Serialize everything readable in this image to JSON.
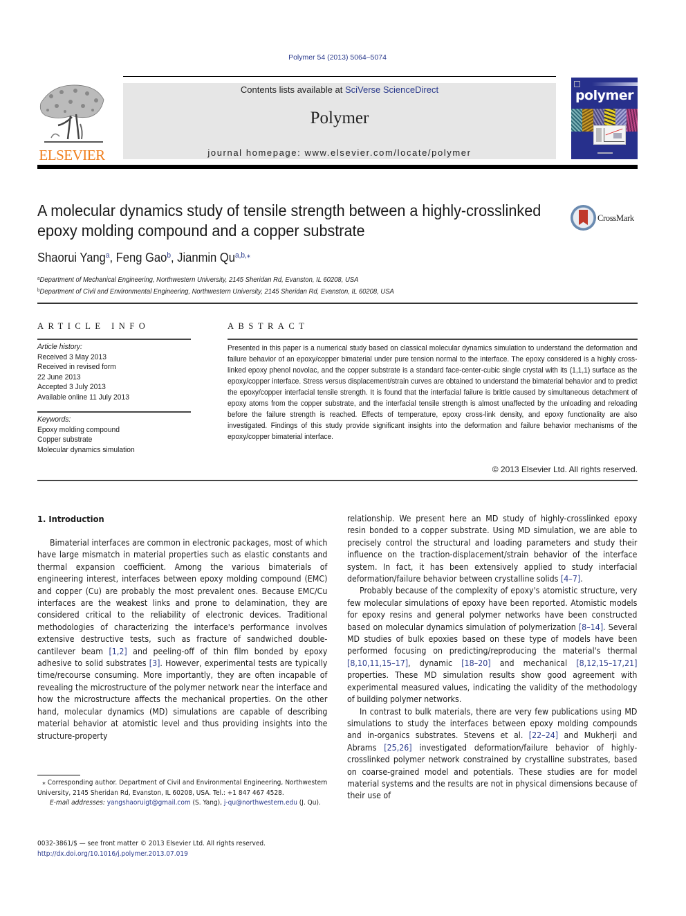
{
  "header": {
    "citation": "Polymer 54 (2013) 5064–5074",
    "contents_prefix": "Contents lists available at ",
    "contents_link": "SciVerse ScienceDirect",
    "journal_name": "Polymer",
    "homepage": "journal homepage: www.elsevier.com/locate/polymer",
    "publisher": "ELSEVIER",
    "cover_title": "polymer",
    "crossmark_label": "CrossMark"
  },
  "colors": {
    "link": "#2a3a8c",
    "elsevier_orange": "#f07f1e",
    "journal_box": "#e6e6e6",
    "cover_blue": "#27308c"
  },
  "article": {
    "title": "A molecular dynamics study of tensile strength between a highly-crosslinked epoxy molding compound and a copper substrate",
    "authors": [
      {
        "name": "Shaorui Yang",
        "sup": "a"
      },
      {
        "name": "Feng Gao",
        "sup": "b"
      },
      {
        "name": "Jianmin Qu",
        "sup": "a,b,⁎"
      }
    ],
    "affiliations": [
      {
        "mark": "a",
        "text": "Department of Mechanical Engineering, Northwestern University, 2145 Sheridan Rd, Evanston, IL 60208, USA"
      },
      {
        "mark": "b",
        "text": "Department of Civil and Environmental Engineering, Northwestern University, 2145 Sheridan Rd, Evanston, IL 60208, USA"
      }
    ]
  },
  "article_info": {
    "heading": "ARTICLE INFO",
    "history_label": "Article history:",
    "history": [
      "Received 3 May 2013",
      "Received in revised form",
      "22 June 2013",
      "Accepted 3 July 2013",
      "Available online 11 July 2013"
    ],
    "keywords_label": "Keywords:",
    "keywords": [
      "Epoxy molding compound",
      "Copper substrate",
      "Molecular dynamics simulation"
    ]
  },
  "abstract": {
    "heading": "ABSTRACT",
    "text": "Presented in this paper is a numerical study based on classical molecular dynamics simulation to understand the deformation and failure behavior of an epoxy/copper bimaterial under pure tension normal to the interface. The epoxy considered is a highly cross-linked epoxy phenol novolac, and the copper substrate is a standard face-center-cubic single crystal with its (1,1,1) surface as the epoxy/copper interface. Stress versus displacement/strain curves are obtained to understand the bimaterial behavior and to predict the epoxy/copper interfacial tensile strength. It is found that the interfacial failure is brittle caused by simultaneous detachment of epoxy atoms from the copper substrate, and the interfacial tensile strength is almost unaffected by the unloading and reloading before the failure strength is reached. Effects of temperature, epoxy cross-link density, and epoxy functionality are also investigated. Findings of this study provide significant insights into the deformation and failure behavior mechanisms of the epoxy/copper bimaterial interface.",
    "copyright": "© 2013 Elsevier Ltd. All rights reserved."
  },
  "body": {
    "section_heading": "1.  Introduction",
    "left_column": [
      {
        "text": "Bimaterial interfaces are common in electronic packages, most of which have large mismatch in material properties such as elastic constants and thermal expansion coefficient. Among the various bimaterials of engineering interest, interfaces between epoxy molding compound (EMC) and copper (Cu) are probably the most prevalent ones. Because EMC/Cu interfaces are the weakest links and prone to delamination, they are considered critical to the reliability of electronic devices. Traditional methodologies of characterizing the interface's performance involves extensive destructive tests, such as fracture of sandwiched double-cantilever beam "
      },
      {
        "ref": "[1,2]"
      },
      {
        "text": " and peeling-off of thin film bonded by epoxy adhesive to solid substrates "
      },
      {
        "ref": "[3]"
      },
      {
        "text": ". However, experimental tests are typically time/recourse consuming. More importantly, they are often incapable of revealing the microstructure of the polymer network near the interface and how the microstructure affects the mechanical properties. On the other hand, molecular dynamics (MD) simulations are capable of describing material behavior at atomistic level and thus providing insights into the structure-property"
      }
    ],
    "right_p1": [
      {
        "text": "relationship. We present here an MD study of highly-crosslinked epoxy resin bonded to a copper substrate. Using MD simulation, we are able to precisely control the structural and loading parameters and study their influence on the traction-displacement/strain behavior of the interface system. In fact, it has been extensively applied to study interfacial deformation/failure behavior between crystalline solids "
      },
      {
        "ref": "[4–7]"
      },
      {
        "text": "."
      }
    ],
    "right_p2": [
      {
        "text": "Probably because of the complexity of epoxy's atomistic structure, very few molecular simulations of epoxy have been reported. Atomistic models for epoxy resins and general polymer networks have been constructed based on molecular dynamics simulation of polymerization "
      },
      {
        "ref": "[8–14]"
      },
      {
        "text": ". Several MD studies of bulk epoxies based on these type of models have been performed focusing on predicting/reproducing the material's thermal "
      },
      {
        "ref": "[8,10,11,15–17]"
      },
      {
        "text": ", dynamic "
      },
      {
        "ref": "[18–20]"
      },
      {
        "text": " and mechanical "
      },
      {
        "ref": "[8,12,15–17,21]"
      },
      {
        "text": " properties. These MD simulation results show good agreement with experimental measured values, indicating the validity of the methodology of building polymer networks."
      }
    ],
    "right_p3": [
      {
        "text": "In contrast to bulk materials, there are very few publications using MD simulations to study the interfaces between epoxy molding compounds and in-organics substrates. Stevens et al. "
      },
      {
        "ref": "[22–24]"
      },
      {
        "text": " and Mukherji and Abrams "
      },
      {
        "ref": "[25,26]"
      },
      {
        "text": " investigated deformation/failure behavior of highly-crosslinked polymer network constrained by crystalline substrates, based on coarse-grained model and potentials. These studies are for model material systems and the results are not in physical dimensions because of their use of"
      }
    ]
  },
  "footnotes": {
    "corresponding": "⁎ Corresponding author. Department of Civil and Environmental Engineering, Northwestern University, 2145 Sheridan Rd, Evanston, IL 60208, USA. Tel.: +1 847 467 4528.",
    "email_label": "E-mail addresses: ",
    "email1": "yangshaoruigt@gmail.com",
    "email1_owner": " (S. Yang), ",
    "email2": "j-qu@northwestern.edu",
    "email2_owner": " (J. Qu).",
    "front_matter": "0032-3861/$ — see front matter © 2013 Elsevier Ltd. All rights reserved.",
    "doi": "http://dx.doi.org/10.1016/j.polymer.2013.07.019"
  }
}
